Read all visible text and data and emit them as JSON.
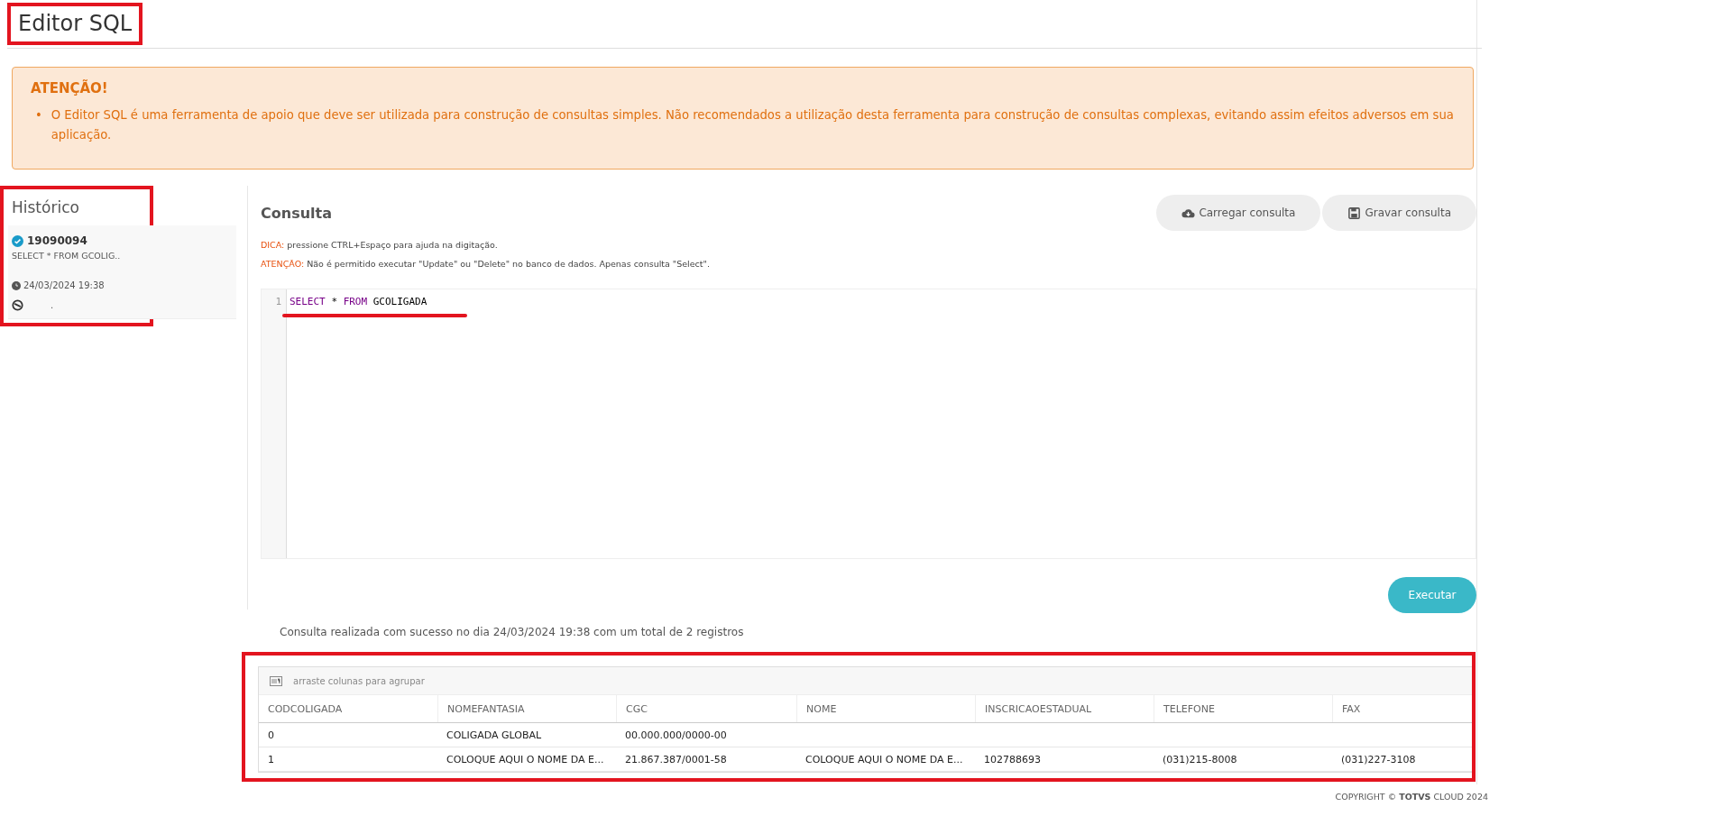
{
  "page": {
    "title": "Editor SQL"
  },
  "alert": {
    "heading": "ATENÇÃO!",
    "items": [
      {
        "marker": "•",
        "text": "O Editor SQL é uma ferramenta de apoio que deve ser utilizada para construção de consultas simples. Não recomendados a utilização desta ferramenta para construção de consultas complexas, evitando assim efeitos adversos em sua aplicação."
      }
    ]
  },
  "history": {
    "title": "Histórico",
    "entries": [
      {
        "id": "19090094",
        "query": "SELECT * FROM GCOLIG..",
        "datetime": "24/03/2024 19:38",
        "verified": true,
        "note": "."
      }
    ]
  },
  "query": {
    "title": "Consulta",
    "buttons": [
      {
        "label": "Carregar consulta",
        "kind": "load"
      },
      {
        "label": "Gravar consulta",
        "kind": "save"
      }
    ],
    "hints": [
      {
        "prefix": "DICA:",
        "text": "pressione CTRL+Espaço para ajuda na digitação."
      },
      {
        "prefix": "ATENÇÃO:",
        "text": "Não é permitido executar \"Update\" ou \"Delete\" no banco de dados. Apenas consulta \"Select\"."
      }
    ],
    "editor": {
      "lines": [
        {
          "number": "1",
          "tokens": [
            {
              "text": "SELECT",
              "kind": "keyword"
            },
            {
              "text": "*",
              "kind": "plain"
            },
            {
              "text": "FROM",
              "kind": "keyword"
            },
            {
              "text": "GCOLIGADA",
              "kind": "plain"
            }
          ]
        }
      ]
    },
    "run_button": "Executar"
  },
  "result": {
    "message": "Consulta realizada com sucesso no dia 24/03/2024 19:38 com um total de 2 registros",
    "group_hint": "arraste colunas para agrupar",
    "columns": [
      "CODCOLIGADA",
      "NOMEFANTASIA",
      "CGC",
      "NOME",
      "INSCRICAOESTADUAL",
      "TELEFONE",
      "FAX"
    ],
    "rows": [
      [
        "0",
        "COLIGADA GLOBAL",
        "00.000.000/0000-00",
        "",
        "",
        "",
        ""
      ],
      [
        "1",
        "COLOQUE AQUI O NOME DA E...",
        "21.867.387/0001-58",
        "COLOQUE AQUI O NOME DA E...",
        "102788693",
        "(031)215-8008",
        "(031)227-3108"
      ]
    ]
  },
  "footer": "COPYRIGHT © **TOTVS** CLOUD 2024",
  "annotations": {
    "title_box": true,
    "history_box": true,
    "code_underline": true,
    "results_box": true
  }
}
